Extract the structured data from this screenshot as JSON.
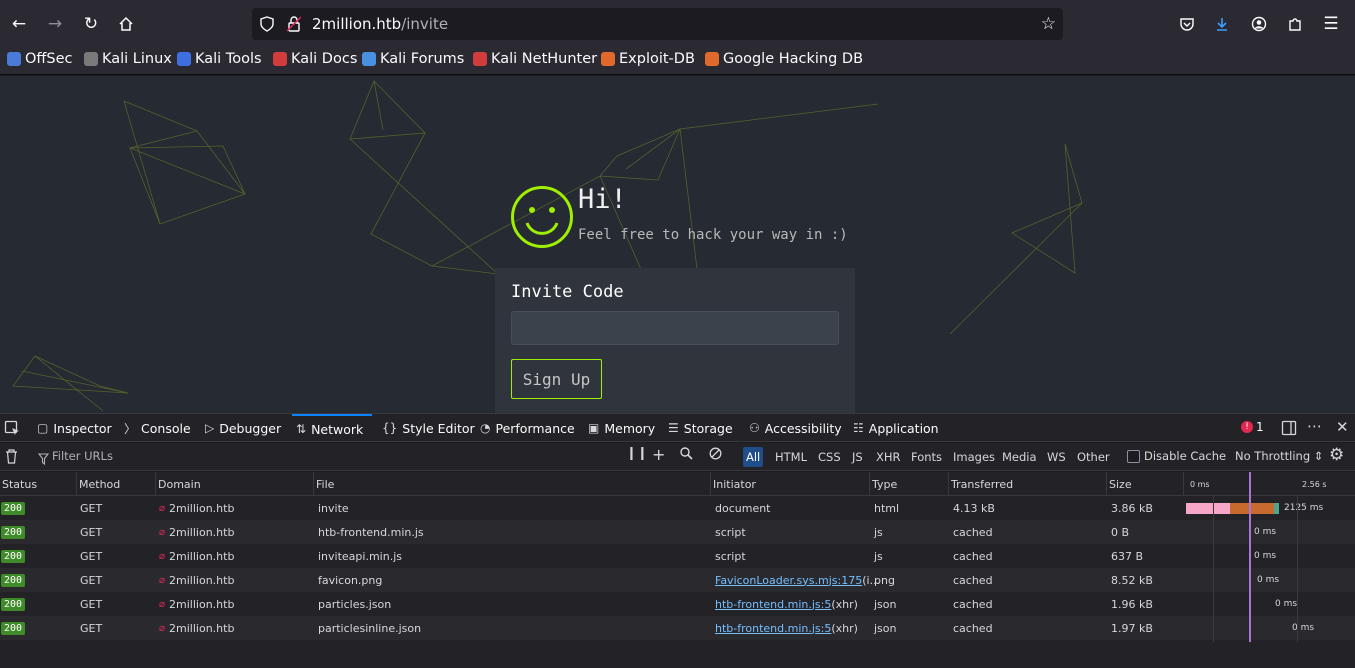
{
  "browser": {
    "url_host": "2million.htb",
    "url_path": "/invite",
    "bookmarks": [
      {
        "label": "OffSec",
        "icon": "offsec-icon",
        "color": "#4a7bd8"
      },
      {
        "label": "Kali Linux",
        "icon": "kali-dragon-icon",
        "color": "#7a7a7a"
      },
      {
        "label": "Kali Tools",
        "icon": "kali-tools-icon",
        "color": "#3d6fe0"
      },
      {
        "label": "Kali Docs",
        "icon": "kali-docs-icon",
        "color": "#d23c3c"
      },
      {
        "label": "Kali Forums",
        "icon": "kali-forums-icon",
        "color": "#4a90e2"
      },
      {
        "label": "Kali NetHunter",
        "icon": "nethunter-icon",
        "color": "#d23c3c"
      },
      {
        "label": "Exploit-DB",
        "icon": "exploitdb-icon",
        "color": "#e06a2c"
      },
      {
        "label": "Google Hacking DB",
        "icon": "ghdb-icon",
        "color": "#e06a2c"
      }
    ]
  },
  "page": {
    "greeting": "Hi!",
    "subtitle": "Feel free to hack your way in :)",
    "invite_label": "Invite Code",
    "invite_value": "",
    "signup_label": "Sign Up",
    "accent_color": "#9fef00"
  },
  "devtools": {
    "tabs": [
      {
        "label": "Inspector",
        "icon": "inspector-icon"
      },
      {
        "label": "Console",
        "icon": "console-icon"
      },
      {
        "label": "Debugger",
        "icon": "debugger-icon"
      },
      {
        "label": "Network",
        "icon": "network-icon",
        "active": true
      },
      {
        "label": "Style Editor",
        "icon": "style-editor-icon"
      },
      {
        "label": "Performance",
        "icon": "performance-icon"
      },
      {
        "label": "Memory",
        "icon": "memory-icon"
      },
      {
        "label": "Storage",
        "icon": "storage-icon"
      },
      {
        "label": "Accessibility",
        "icon": "accessibility-icon"
      },
      {
        "label": "Application",
        "icon": "application-icon"
      }
    ],
    "error_count": "1",
    "filter_placeholder": "Filter URLs",
    "type_filters": [
      "All",
      "HTML",
      "CSS",
      "JS",
      "XHR",
      "Fonts",
      "Images",
      "Media",
      "WS",
      "Other"
    ],
    "active_type_filter": "All",
    "disable_cache_label": "Disable Cache",
    "throttling_label": "No Throttling",
    "columns": [
      "Status",
      "Method",
      "Domain",
      "File",
      "Initiator",
      "Type",
      "Transferred",
      "Size"
    ],
    "timeline_ticks": [
      "0 ms",
      "2.56 s"
    ],
    "requests": [
      {
        "status": "200",
        "method": "GET",
        "domain": "2million.htb",
        "file": "invite",
        "initiator": "document",
        "initiator_link": false,
        "initiator_suffix": "",
        "type": "html",
        "transferred": "4.13 kB",
        "size": "3.86 kB",
        "timing": "2125 ms"
      },
      {
        "status": "200",
        "method": "GET",
        "domain": "2million.htb",
        "file": "htb-frontend.min.js",
        "initiator": "script",
        "initiator_link": false,
        "initiator_suffix": "",
        "type": "js",
        "transferred": "cached",
        "size": "0 B",
        "timing": "0 ms"
      },
      {
        "status": "200",
        "method": "GET",
        "domain": "2million.htb",
        "file": "inviteapi.min.js",
        "initiator": "script",
        "initiator_link": false,
        "initiator_suffix": "",
        "type": "js",
        "transferred": "cached",
        "size": "637 B",
        "timing": "0 ms"
      },
      {
        "status": "200",
        "method": "GET",
        "domain": "2million.htb",
        "file": "favicon.png",
        "initiator": "FaviconLoader.sys.mjs:175",
        "initiator_link": true,
        "initiator_suffix": " (i...",
        "type": "png",
        "transferred": "cached",
        "size": "8.52 kB",
        "timing": "0 ms"
      },
      {
        "status": "200",
        "method": "GET",
        "domain": "2million.htb",
        "file": "particles.json",
        "initiator": "htb-frontend.min.js:5",
        "initiator_link": true,
        "initiator_suffix": " (xhr)",
        "type": "json",
        "transferred": "cached",
        "size": "1.96 kB",
        "timing": "0 ms"
      },
      {
        "status": "200",
        "method": "GET",
        "domain": "2million.htb",
        "file": "particlesinline.json",
        "initiator": "htb-frontend.min.js:5",
        "initiator_link": true,
        "initiator_suffix": " (xhr)",
        "type": "json",
        "transferred": "cached",
        "size": "1.97 kB",
        "timing": "0 ms"
      }
    ]
  }
}
